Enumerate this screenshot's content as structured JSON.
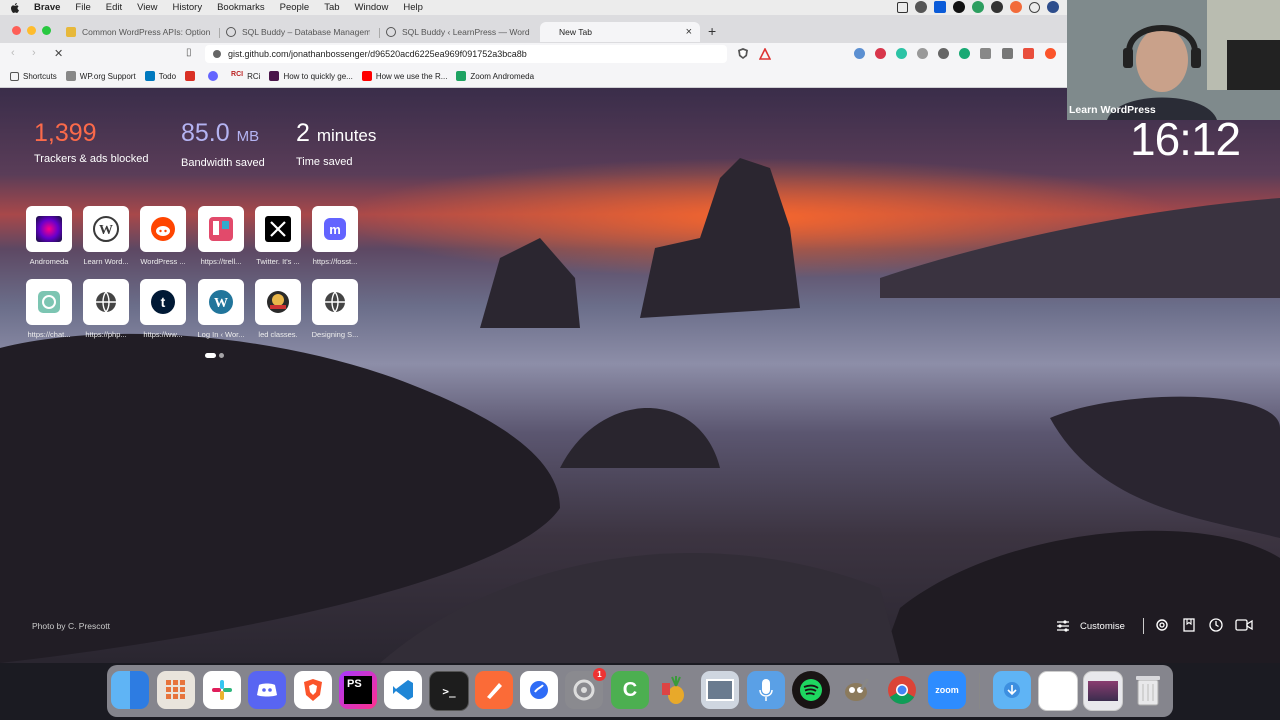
{
  "menubar": {
    "app": "Brave",
    "items": [
      "File",
      "Edit",
      "View",
      "History",
      "Bookmarks",
      "People",
      "Tab",
      "Window",
      "Help"
    ]
  },
  "tabs": [
    {
      "title": "Common WordPress APIs: Options"
    },
    {
      "title": "SQL Buddy – Database Manageme"
    },
    {
      "title": "SQL Buddy ‹ LearnPress — WordPr"
    },
    {
      "title": "New Tab"
    }
  ],
  "toolbar": {
    "url": "gist.github.com/jonathanbossenger/d96520acd6225ea969f091752a3bca8b"
  },
  "bookmarks": [
    {
      "label": "Shortcuts"
    },
    {
      "label": "WP.org Support"
    },
    {
      "label": "Todo"
    },
    {
      "label": ""
    },
    {
      "label": ""
    },
    {
      "label": "RCi"
    },
    {
      "label": "How to quickly ge..."
    },
    {
      "label": "How we use the R..."
    },
    {
      "label": "Zoom Andromeda"
    }
  ],
  "stats": {
    "trackers": {
      "value": "1,399",
      "label": "Trackers & ads blocked"
    },
    "bandwidth": {
      "value": "85.0",
      "unit": "MB",
      "label": "Bandwidth saved"
    },
    "time": {
      "value": "2",
      "unit": "minutes",
      "label": "Time saved"
    }
  },
  "clock": "16:12",
  "shortcuts": [
    {
      "label": "Andromeda"
    },
    {
      "label": "Learn Word..."
    },
    {
      "label": "WordPress ..."
    },
    {
      "label": "https://trell..."
    },
    {
      "label": "Twitter. It's ..."
    },
    {
      "label": "https://fosst..."
    },
    {
      "label": "https://chat..."
    },
    {
      "label": "https://php..."
    },
    {
      "label": "https://ww..."
    },
    {
      "label": "Log In ‹ Wor..."
    },
    {
      "label": "led classes."
    },
    {
      "label": "Designing S..."
    }
  ],
  "photo_credit": {
    "prefix": "Photo by",
    "author": "C. Prescott"
  },
  "customise_label": "Customise",
  "webcam_caption": "Learn WordPress",
  "dock_badge": "1"
}
